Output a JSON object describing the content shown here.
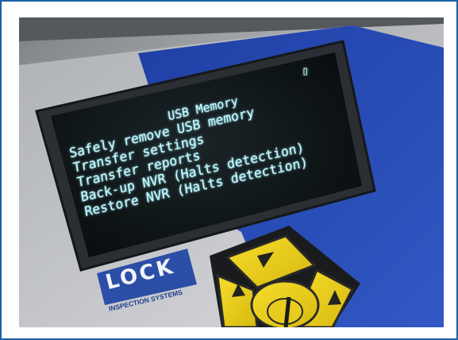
{
  "screen": {
    "title": "USB Memory",
    "menu_items": [
      "Safely remove USB memory",
      "Transfer settings",
      "Transfer reports",
      "Back-up NVR (Halts detection)",
      "Restore NVR (Halts detection)"
    ],
    "status_glyph": "▯"
  },
  "logo": {
    "name": "LOCK",
    "tagline": "INSPECTION SYSTEMS"
  },
  "colors": {
    "frame_border": "#1a5fa8",
    "panel_blue": "#2a4fb6",
    "panel_grey": "#c9cbcf",
    "display_bg": "#0e1416",
    "display_text": "#bff7ff",
    "keypad_yellow": "#efd21a"
  },
  "icons": [
    "usb-status-icon",
    "arrow-up-icon",
    "arrow-left-icon",
    "arrow-right-icon"
  ]
}
